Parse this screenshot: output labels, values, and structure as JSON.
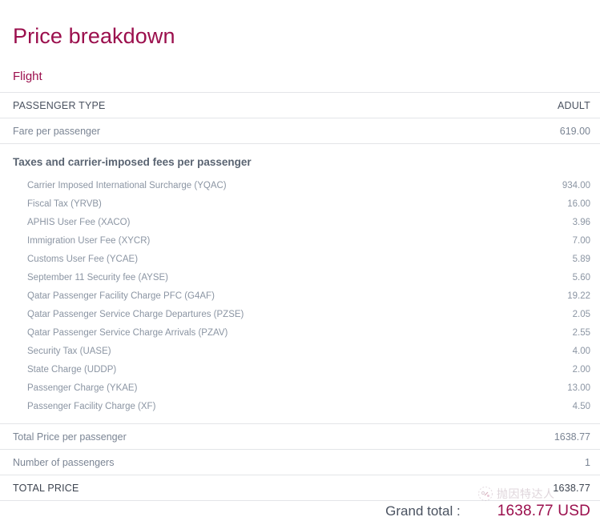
{
  "page": {
    "title": "Price breakdown",
    "section_title": "Flight",
    "accent_color": "#9b0f4d",
    "text_color": "#7b8594",
    "rule_color": "#e3e5e8"
  },
  "table": {
    "header": {
      "label": "PASSENGER TYPE",
      "value": "ADULT"
    },
    "fare_row": {
      "label": "Fare per passenger",
      "value": "619.00"
    },
    "taxes_heading": "Taxes and carrier-imposed fees per passenger",
    "taxes": [
      {
        "label": "Carrier Imposed International Surcharge (YQAC)",
        "value": "934.00"
      },
      {
        "label": "Fiscal Tax (YRVB)",
        "value": "16.00"
      },
      {
        "label": "APHIS User Fee (XACO)",
        "value": "3.96"
      },
      {
        "label": "Immigration User Fee (XYCR)",
        "value": "7.00"
      },
      {
        "label": "Customs User Fee (YCAE)",
        "value": "5.89"
      },
      {
        "label": "September 11 Security fee (AYSE)",
        "value": "5.60"
      },
      {
        "label": "Qatar Passenger Facility Charge PFC (G4AF)",
        "value": "19.22"
      },
      {
        "label": "Qatar Passenger Service Charge Departures (PZSE)",
        "value": "2.05"
      },
      {
        "label": "Qatar Passenger Service Charge Arrivals (PZAV)",
        "value": "2.55"
      },
      {
        "label": "Security Tax (UASE)",
        "value": "4.00"
      },
      {
        "label": "State Charge (UDDP)",
        "value": "2.00"
      },
      {
        "label": "Passenger Charge (YKAE)",
        "value": "13.00"
      },
      {
        "label": "Passenger Facility Charge (XF)",
        "value": "4.50"
      }
    ],
    "total_per_passenger": {
      "label": "Total Price per passenger",
      "value": "1638.77"
    },
    "number_of_passengers": {
      "label": "Number of passengers",
      "value": "1"
    },
    "total_price": {
      "label": "TOTAL PRICE",
      "value": "1638.77"
    }
  },
  "grand_total": {
    "label": "Grand total :",
    "value": "1638.77 USD"
  },
  "watermark": {
    "text": "抛因特达人",
    "icon": "circle-logo-icon"
  }
}
